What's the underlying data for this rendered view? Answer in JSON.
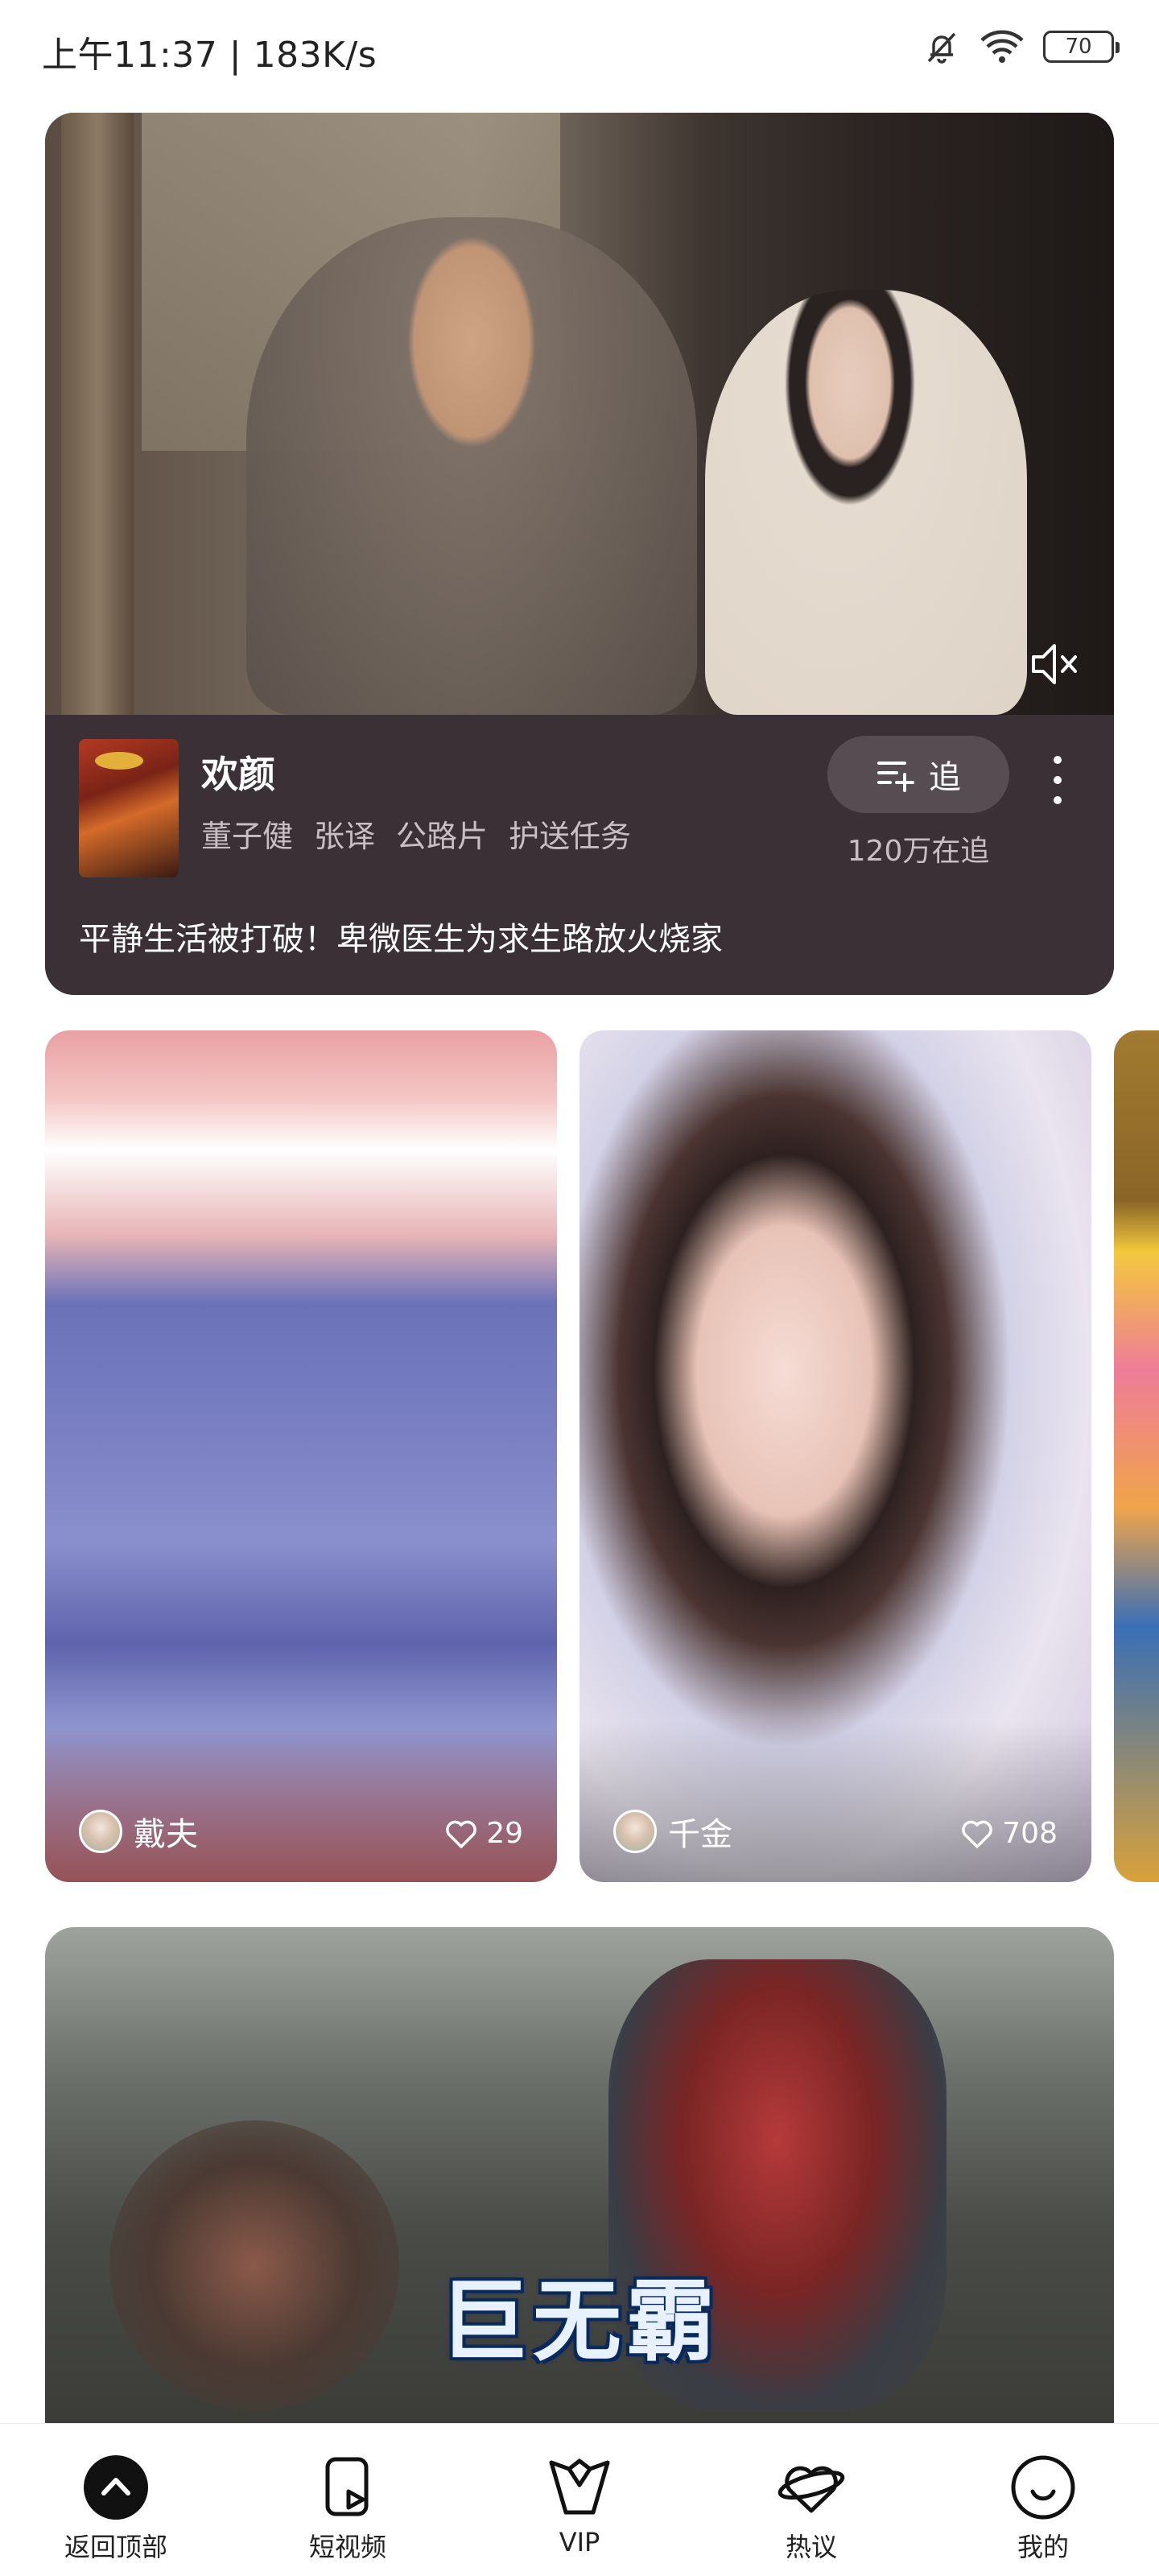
{
  "status_bar": {
    "time": "上午11:37 | 183K/s",
    "battery": "70"
  },
  "feature": {
    "title": "欢颜",
    "tags": [
      "董子健",
      "张译",
      "公路片",
      "护送任务"
    ],
    "follow_label": "追",
    "follow_count": "120万在追",
    "description": "平静生活被打破！卑微医生为求生路放火烧家"
  },
  "short_videos": [
    {
      "author": "戴夫",
      "likes": "29"
    },
    {
      "author": "千金",
      "likes": "708"
    }
  ],
  "wide_card": {
    "subtitle": "巨无霸"
  },
  "bottom_nav": [
    {
      "label": "返回顶部",
      "icon": "back-to-top-icon"
    },
    {
      "label": "短视频",
      "icon": "short-video-icon"
    },
    {
      "label": "VIP",
      "icon": "vip-icon"
    },
    {
      "label": "热议",
      "icon": "hot-discuss-icon"
    },
    {
      "label": "我的",
      "icon": "profile-icon"
    }
  ]
}
